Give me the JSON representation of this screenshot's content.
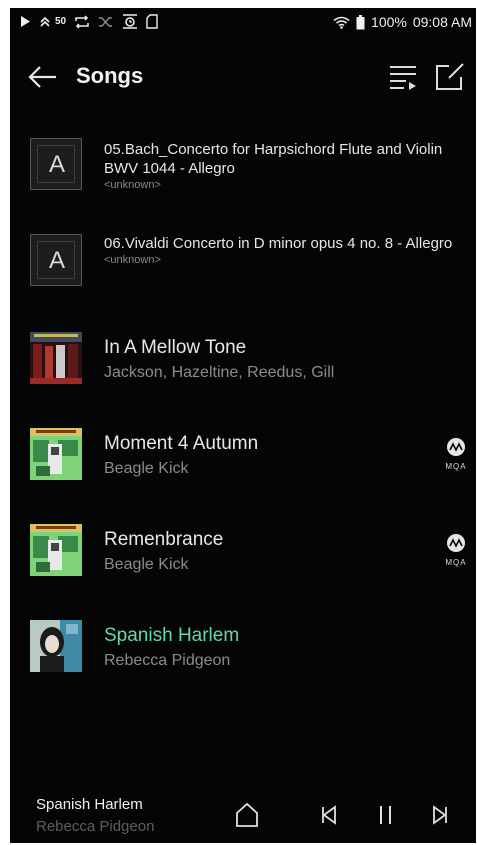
{
  "status_bar": {
    "signal_label": "50",
    "battery_text": "100%",
    "time": "09:08 AM",
    "icons": [
      "play-icon",
      "signal-icon",
      "repeat-icon",
      "shuffle-icon",
      "equalizer-icon",
      "sd-card-icon",
      "wifi-icon",
      "battery-icon"
    ]
  },
  "app_bar": {
    "title": "Songs",
    "icons": [
      "back-arrow-icon",
      "queue-icon",
      "edit-icon"
    ]
  },
  "songs": [
    {
      "title": "05.Bach_Concerto for Harpsichord Flute and Violin BWV 1044 - Allegro",
      "artist": "<unknown>",
      "art": "placeholder",
      "art_letter": "A",
      "mqa": false,
      "playing": false
    },
    {
      "title": "06.Vivaldi Concerto in D minor opus 4 no. 8 - Allegro",
      "artist": "<unknown>",
      "art": "placeholder",
      "art_letter": "A",
      "mqa": false,
      "playing": false
    },
    {
      "title": "In A Mellow Tone",
      "artist": "Jackson, Hazeltine, Reedus, Gill",
      "art": "album-cover",
      "mqa": false,
      "playing": false
    },
    {
      "title": "Moment 4 Autumn",
      "artist": "Beagle Kick",
      "art": "album-cover",
      "mqa": true,
      "playing": false
    },
    {
      "title": "Remenbrance",
      "artist": "Beagle Kick",
      "art": "album-cover",
      "mqa": true,
      "playing": false
    },
    {
      "title": "Spanish Harlem",
      "artist": "Rebecca Pidgeon",
      "art": "album-cover",
      "mqa": false,
      "playing": true
    }
  ],
  "mqa_label": "MQA",
  "now_playing": {
    "title": "Spanish Harlem",
    "artist": "Rebecca Pidgeon"
  },
  "controls": [
    "home-icon",
    "previous-icon",
    "pause-icon",
    "next-icon"
  ],
  "colors": {
    "background": "#050505",
    "playing_accent": "#63d6b4",
    "secondary_text": "#8c8c8c"
  }
}
